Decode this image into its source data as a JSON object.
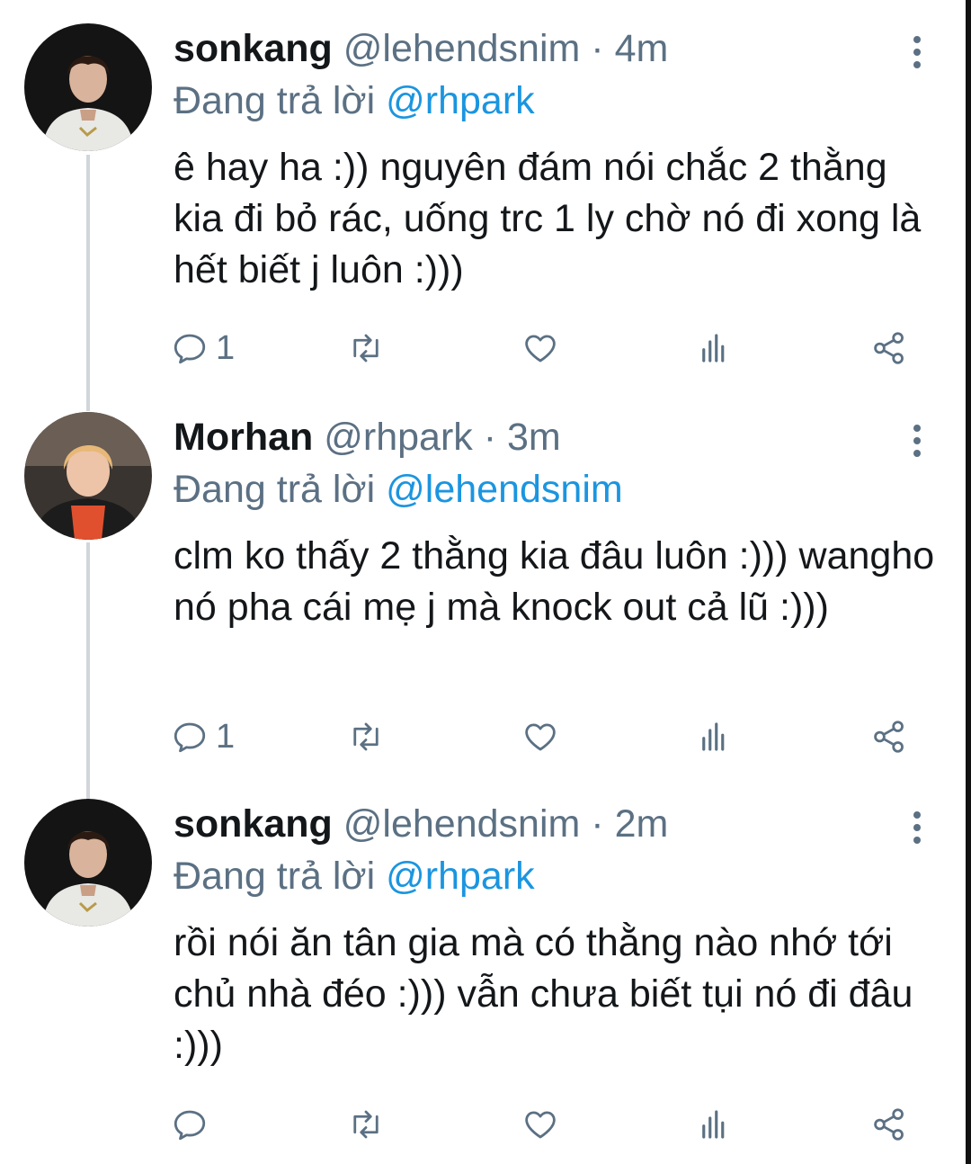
{
  "tweets": [
    {
      "name": "sonkang",
      "handle": "@lehendsnim",
      "separator": " · ",
      "time": "4m",
      "reply_prefix": "Đang trả lời ",
      "reply_to": "@rhpark",
      "text": "ê hay ha :)) nguyên đám nói chắc 2 thằng kia đi bỏ rác, uống trc 1 ly chờ nó đi xong là hết biết j luôn :)))",
      "reply_count": "1",
      "avatar": "sonkang-avatar"
    },
    {
      "name": "Morhan",
      "handle": "@rhpark",
      "separator": " · ",
      "time": "3m",
      "reply_prefix": "Đang trả lời ",
      "reply_to": "@lehendsnim",
      "text": "clm ko thấy 2 thằng kia đâu luôn :))) wangho nó pha cái mẹ j mà knock out cả lũ :)))",
      "reply_count": "1",
      "avatar": "morhan-avatar"
    },
    {
      "name": "sonkang",
      "handle": "@lehendsnim",
      "separator": " · ",
      "time": "2m",
      "reply_prefix": "Đang trả lời ",
      "reply_to": "@rhpark",
      "text": "rồi nói ăn tân gia mà có thằng nào nhớ tới chủ nhà đéo :))) vẫn chưa biết tụi nó đi đâu :)))",
      "reply_count": "",
      "avatar": "sonkang-avatar"
    }
  ],
  "icons": [
    "reply-icon",
    "retweet-icon",
    "like-icon",
    "analytics-icon",
    "share-icon",
    "more-options-icon"
  ],
  "colors": {
    "name": "#14171a",
    "secondary": "#5b7083",
    "mention": "#1b95e0",
    "thread_line": "#d1d6db"
  }
}
